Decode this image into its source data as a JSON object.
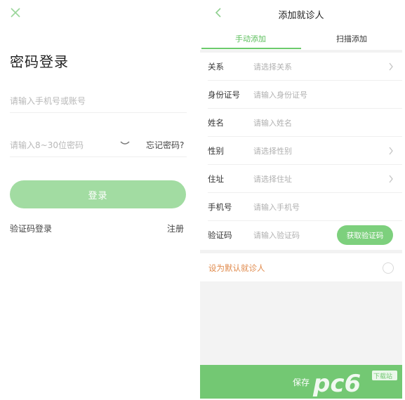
{
  "left": {
    "title": "密码登录",
    "account_placeholder": "请输入手机号或账号",
    "password_placeholder": "请输入8~30位密码",
    "forgot_label": "忘记密码?",
    "login_label": "登录",
    "sms_login_label": "验证码登录",
    "register_label": "注册"
  },
  "right": {
    "title": "添加就诊人",
    "tabs": [
      {
        "label": "手动添加",
        "active": true
      },
      {
        "label": "扫描添加",
        "active": false
      }
    ],
    "rows": [
      {
        "label": "关系",
        "placeholder": "请选择关系",
        "chevron": true
      },
      {
        "label": "身份证号",
        "placeholder": "请输入身份证号",
        "chevron": false
      },
      {
        "label": "姓名",
        "placeholder": "请输入姓名",
        "chevron": false
      },
      {
        "label": "性别",
        "placeholder": "请选择性别",
        "chevron": true
      },
      {
        "label": "住址",
        "placeholder": "请选择住址",
        "chevron": true
      },
      {
        "label": "手机号",
        "placeholder": "请输入手机号",
        "chevron": false
      },
      {
        "label": "验证码",
        "placeholder": "请输入验证码",
        "chevron": false
      }
    ],
    "get_code_label": "获取验证码",
    "default_label": "设为默认就诊人",
    "save_label": "保存"
  },
  "watermark": {
    "text": "pc6",
    "sub": "下载站"
  },
  "colors": {
    "accent": "#73c873",
    "accent_light": "#a2dca2",
    "orange": "#e08a4c"
  }
}
